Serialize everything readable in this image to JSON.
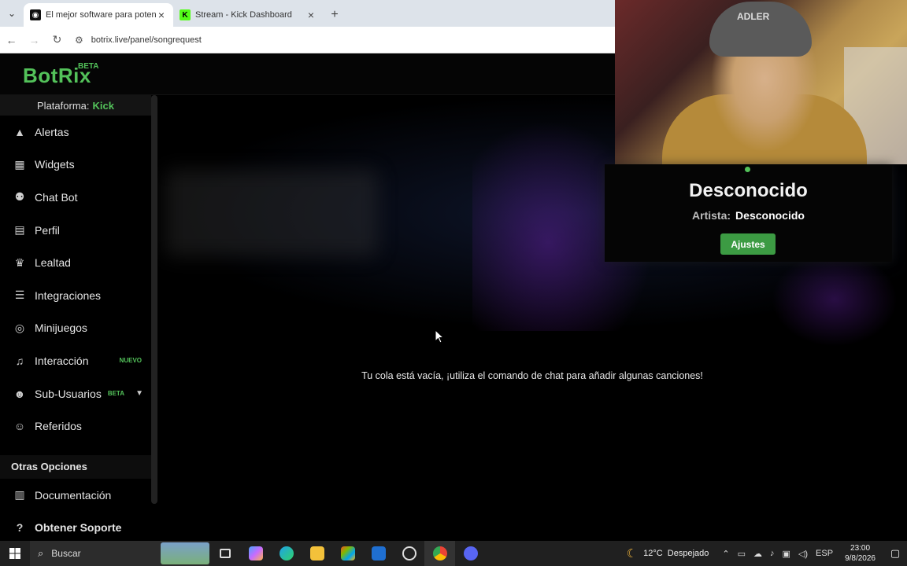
{
  "browser": {
    "tabs": [
      {
        "title": "El mejor software para potenciar",
        "active": true
      },
      {
        "title": "Stream - Kick Dashboard",
        "active": false
      }
    ],
    "url": "botrix.live/panel/songrequest"
  },
  "app": {
    "logo": "BotRix",
    "logo_badge": "BETA",
    "platform_label": "Plataforma:",
    "platform_value": "Kick",
    "menu": [
      {
        "label": "Alertas",
        "icon": "alert-icon"
      },
      {
        "label": "Widgets",
        "icon": "grid-icon"
      },
      {
        "label": "Chat Bot",
        "icon": "robot-icon"
      },
      {
        "label": "Perfil",
        "icon": "id-card-icon"
      },
      {
        "label": "Lealtad",
        "icon": "trophy-icon"
      },
      {
        "label": "Integraciones",
        "icon": "list-icon"
      },
      {
        "label": "Minijuegos",
        "icon": "gamepad-icon"
      },
      {
        "label": "Interacción",
        "icon": "music-icon",
        "badge": "NUEVO"
      },
      {
        "label": "Sub-Usuarios",
        "icon": "users-icon",
        "badge": "BETA"
      },
      {
        "label": "Referidos",
        "icon": "user-group-icon"
      }
    ],
    "other_section": "Otras Opciones",
    "other_menu": [
      {
        "label": "Documentación",
        "icon": "book-icon"
      },
      {
        "label": "Obtener Soporte",
        "icon": "help-icon"
      }
    ],
    "empty_queue": "Tu cola está vacía, ¡utiliza el comando de chat para añadir algunas canciones!",
    "now_playing": {
      "title": "Desconocido",
      "artist_label": "Artista:",
      "artist_value": "Desconocido",
      "settings_button": "Ajustes"
    },
    "webcam_cap_text": "ADLER"
  },
  "taskbar": {
    "search_placeholder": "Buscar",
    "weather": "12°C  Despejado",
    "lang": "ESP",
    "time": "23:00",
    "date": "9/8/2026"
  }
}
